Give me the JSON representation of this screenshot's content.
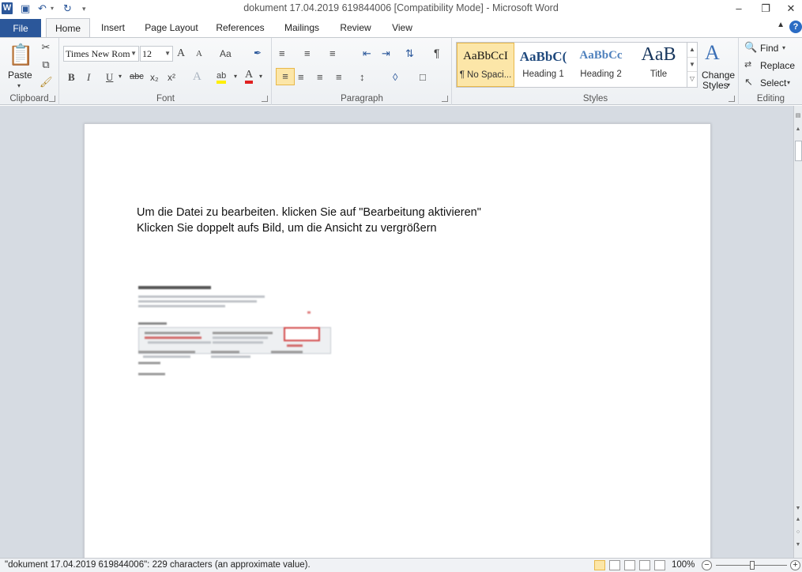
{
  "titlebar": {
    "app_icon_letter": "W",
    "title": "dokument 17.04.2019 619844006 [Compatibility Mode]  -  Microsoft Word",
    "minimize": "–",
    "restore": "❐",
    "close": "✕"
  },
  "tabs": [
    {
      "label": "File"
    },
    {
      "label": "Home"
    },
    {
      "label": "Insert"
    },
    {
      "label": "Page Layout"
    },
    {
      "label": "References"
    },
    {
      "label": "Mailings"
    },
    {
      "label": "Review"
    },
    {
      "label": "View"
    }
  ],
  "help_label": "?",
  "ribbon": {
    "clipboard": {
      "label": "Clipboard",
      "paste": "Paste"
    },
    "font": {
      "label": "Font",
      "font_name": "Times New Rom",
      "font_size": "12",
      "grow": "A",
      "shrink": "A",
      "case": "Aa",
      "bold": "B",
      "italic": "I",
      "underline": "U",
      "strike": "abc",
      "sub": "x₂",
      "sup": "x²",
      "effects": "A",
      "highlight": "ab",
      "color": "A"
    },
    "paragraph": {
      "label": "Paragraph",
      "pilcrow": "¶"
    },
    "styles": {
      "label": "Styles",
      "items": [
        {
          "sample": "AaBbCcI",
          "name": "¶ No Spaci..."
        },
        {
          "sample": "AaBbC(",
          "name": "Heading 1"
        },
        {
          "sample": "AaBbCc",
          "name": "Heading 2"
        },
        {
          "sample": "AaB",
          "name": "Title"
        }
      ],
      "change_styles_1": "Change",
      "change_styles_2": "Styles"
    },
    "editing": {
      "label": "Editing",
      "find": "Find",
      "replace": "Replace",
      "select": "Select"
    }
  },
  "document": {
    "line1": "Um die Datei zu bearbeiten. klicken Sie auf \"Bearbeitung aktivieren\"",
    "line2": "Klicken Sie doppelt aufs Bild, um die Ansicht zu vergrößern"
  },
  "statusbar": {
    "stats": "\"dokument 17.04.2019 619844006\": 229 characters (an approximate value).",
    "zoom": "100%",
    "zoom_out": "−",
    "zoom_in": "+"
  },
  "colors": {
    "file_tab": "#2b579a",
    "workspace": "#d6dbe2",
    "selected_style": "#fce6a8"
  }
}
